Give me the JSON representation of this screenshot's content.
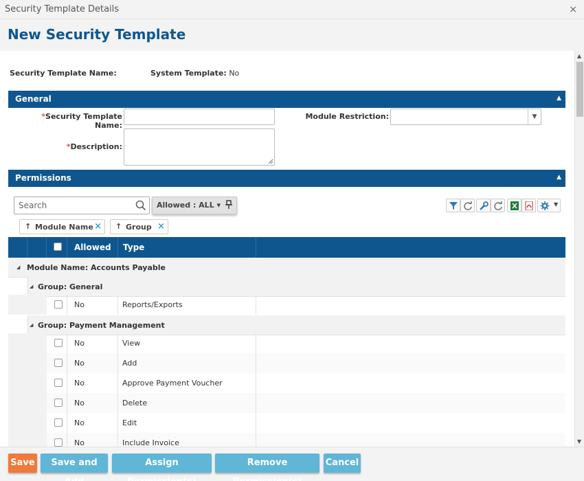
{
  "window": {
    "title": "Security Template Details",
    "close_glyph": "×"
  },
  "page": {
    "title": "New Security Template"
  },
  "info": {
    "name_label": "Security Template Name:",
    "system_label": "System Template:",
    "system_value": "No"
  },
  "general": {
    "title": "General",
    "fields": {
      "template_name_label": "Security Template Name:",
      "description_label": "Description:",
      "module_restriction_label": "Module Restriction:",
      "required_mark": "*"
    }
  },
  "permissions": {
    "title": "Permissions",
    "search_placeholder": "Search",
    "filter_chip": "Allowed : ALL ▾",
    "pin_glyph": "🖈",
    "group_chips": [
      {
        "label": "Module Name",
        "arrow": "↑",
        "remove": "×"
      },
      {
        "label": "Group",
        "arrow": "↑",
        "remove": "×"
      }
    ],
    "columns": {
      "allowed": "Allowed",
      "type": "Type"
    },
    "toolbar_icons": [
      "filter-icon",
      "refresh-icon",
      "wrench-icon",
      "refresh-icon",
      "excel-icon",
      "pdf-icon",
      "gear-icon"
    ],
    "rows": [
      {
        "kind": "module",
        "text": "Module Name: Accounts Payable"
      },
      {
        "kind": "group",
        "text": "Group: General"
      },
      {
        "kind": "data",
        "allowed": "No",
        "type": "Reports/Exports"
      },
      {
        "kind": "group",
        "text": "Group: Payment Management"
      },
      {
        "kind": "data",
        "allowed": "No",
        "type": "View"
      },
      {
        "kind": "data",
        "allowed": "No",
        "type": "Add"
      },
      {
        "kind": "data",
        "allowed": "No",
        "type": "Approve Payment Voucher"
      },
      {
        "kind": "data",
        "allowed": "No",
        "type": "Delete"
      },
      {
        "kind": "data",
        "allowed": "No",
        "type": "Edit"
      },
      {
        "kind": "data",
        "allowed": "No",
        "type": "Include Invoice"
      }
    ]
  },
  "footer": {
    "save": "Save",
    "save_add": "Save and Add",
    "assign": "Assign Permission(s)",
    "remove": "Remove Permission(s)",
    "cancel": "Cancel"
  },
  "colors": {
    "brand": "#0f568f",
    "save": "#f0793b",
    "action": "#5fb6d6",
    "required": "#d9534f"
  }
}
